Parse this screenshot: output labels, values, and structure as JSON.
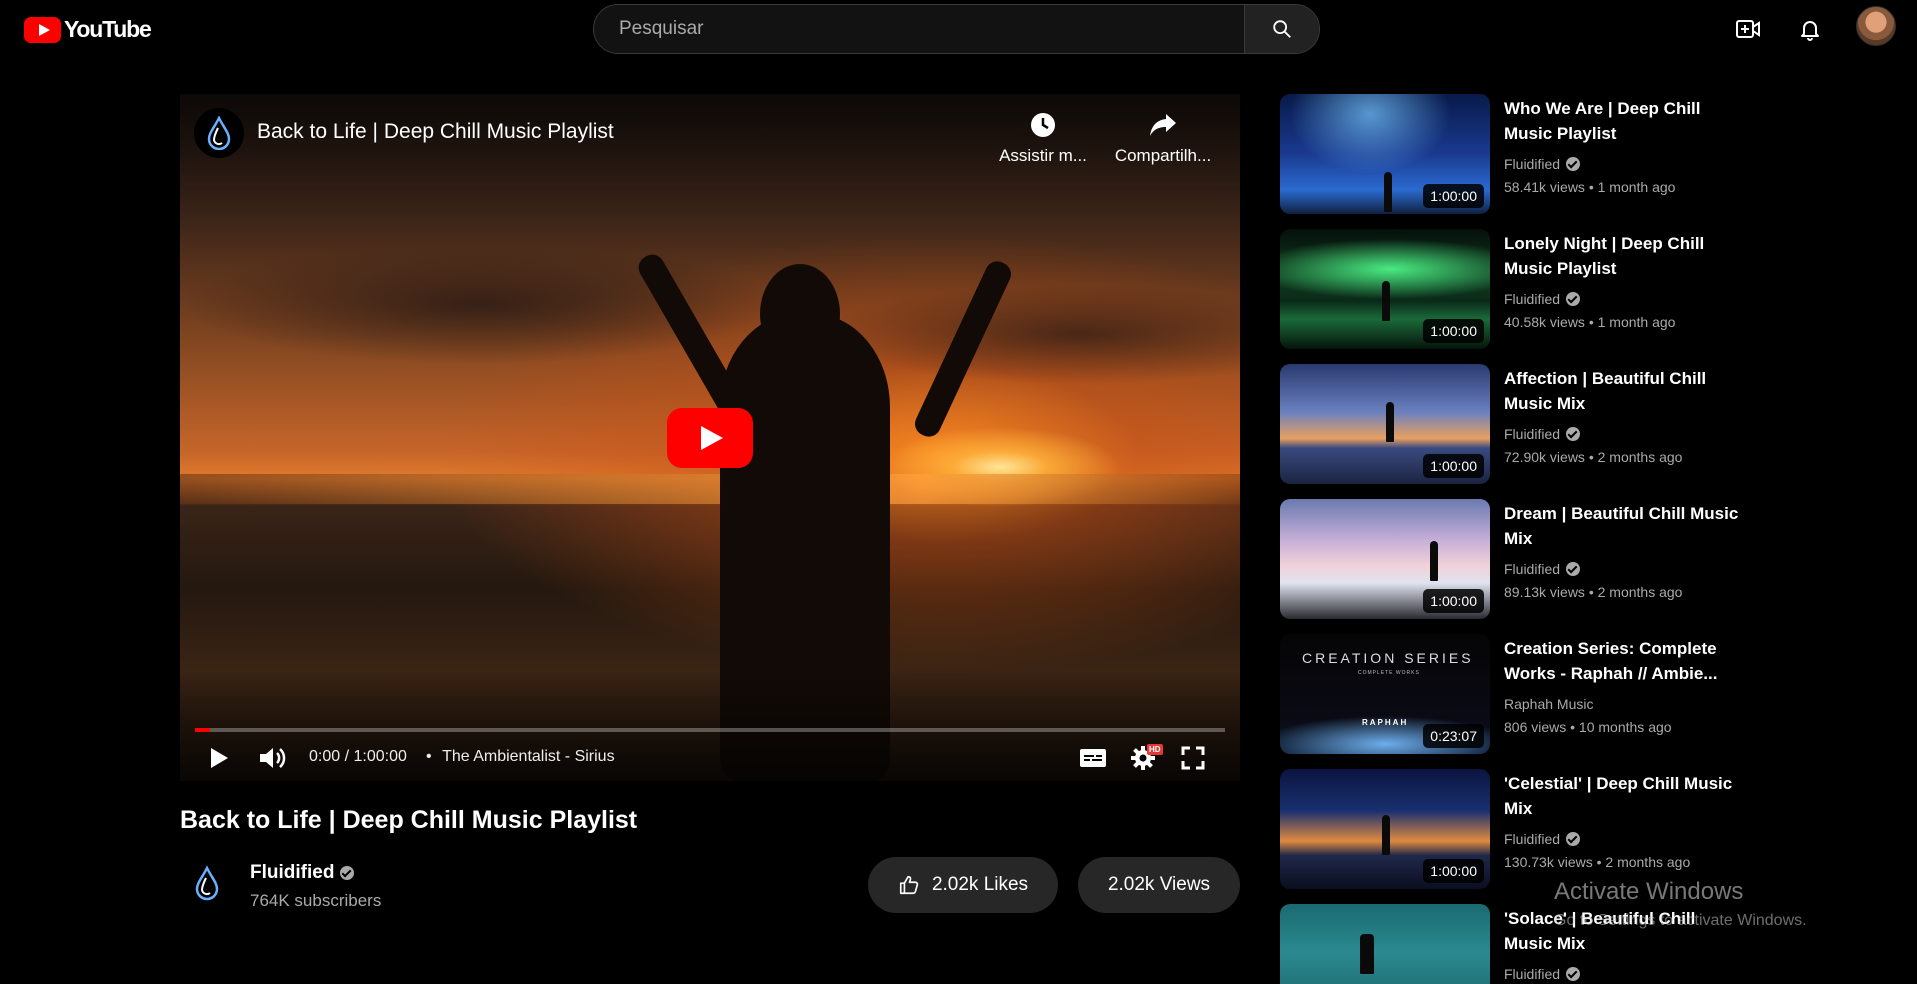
{
  "header": {
    "logo_text": "YouTube",
    "search_placeholder": "Pesquisar"
  },
  "player": {
    "title": "Back to Life | Deep Chill Music Playlist",
    "watch_later_label": "Assistir m...",
    "share_label": "Compartilh...",
    "time": "0:00 / 1:00:00",
    "separator": "•",
    "chapter": "The Ambientalist - Sirius",
    "hd_badge": "HD",
    "progress_fraction": 0.015
  },
  "video": {
    "title": "Back to Life | Deep Chill Music Playlist",
    "channel": "Fluidified",
    "subscribers": "764K subscribers",
    "likes_label": "2.02k Likes",
    "views_label": "2.02k Views"
  },
  "related": [
    {
      "title": "Who We Are | Deep Chill Music Playlist",
      "channel": "Fluidified",
      "verified": true,
      "meta": "58.41k views • 1 month ago",
      "duration": "1:00:00"
    },
    {
      "title": "Lonely Night | Deep Chill Music Playlist",
      "channel": "Fluidified",
      "verified": true,
      "meta": "40.58k views • 1 month ago",
      "duration": "1:00:00"
    },
    {
      "title": "Affection | Beautiful Chill Music Mix",
      "channel": "Fluidified",
      "verified": true,
      "meta": "72.90k views • 2 months ago",
      "duration": "1:00:00"
    },
    {
      "title": "Dream | Beautiful Chill Music Mix",
      "channel": "Fluidified",
      "verified": true,
      "meta": "89.13k views • 2 months ago",
      "duration": "1:00:00"
    },
    {
      "title": "Creation Series: Complete Works - Raphah // Ambie...",
      "channel": "Raphah Music",
      "verified": false,
      "meta": "806 views • 10 months ago",
      "duration": "0:23:07",
      "thumb_text": "CREATION SERIES",
      "thumb_subtext": "COMPLETE WORKS",
      "thumb_artist": "RAPHAH"
    },
    {
      "title": "'Celestial' | Deep Chill Music Mix",
      "channel": "Fluidified",
      "verified": true,
      "meta": "130.73k views • 2 months ago",
      "duration": "1:00:00"
    },
    {
      "title": "'Solace' | Beautiful Chill Music Mix",
      "channel": "Fluidified",
      "verified": true,
      "meta": "",
      "duration": ""
    }
  ],
  "watermark": {
    "line1": "Activate Windows",
    "line2": "Go to Settings to activate Windows."
  }
}
